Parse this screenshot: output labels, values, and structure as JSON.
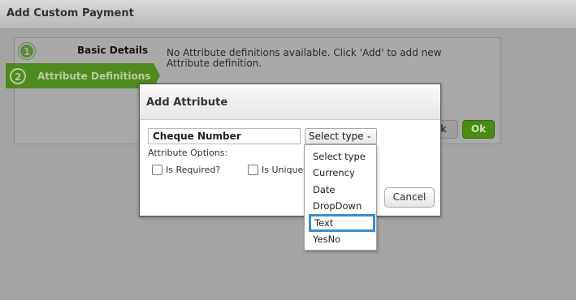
{
  "window": {
    "title": "Add Custom Payment"
  },
  "wizard": {
    "steps": [
      {
        "number": "1",
        "label": "Basic Details"
      },
      {
        "number": "2",
        "label": "Attribute Definitions"
      }
    ],
    "empty_message": "No Attribute definitions available. Click 'Add' to add new Attribute definition.",
    "back_label": "ck",
    "ok_label": "Ok"
  },
  "modal": {
    "title": "Add Attribute",
    "name_value": "Cheque Number",
    "type_select": {
      "selected": "Select type"
    },
    "options_label": "Attribute Options:",
    "checkboxes": [
      {
        "label": "Is Required?",
        "checked": false
      },
      {
        "label": "Is Unique",
        "checked": false
      }
    ],
    "cancel_label": "Cancel"
  },
  "dropdown": {
    "items": [
      "Select type",
      "Currency",
      "Date",
      "DropDown",
      "Text",
      "YesNo"
    ],
    "highlighted": "Text"
  },
  "colors": {
    "accent_green": "#4f8a1e",
    "highlight_blue": "#3a8ecb",
    "overlay_gray": "#a4a4a4"
  }
}
